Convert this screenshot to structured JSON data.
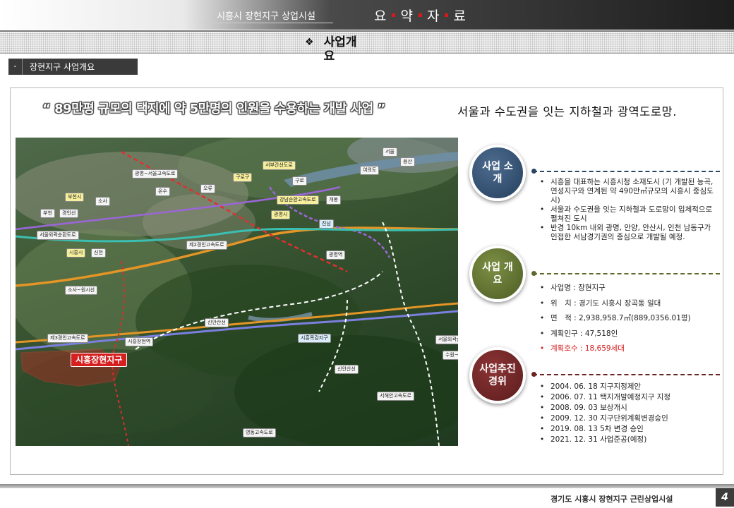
{
  "header": {
    "subtitle": "시흥시 장현지구 상업시설",
    "title_chars": [
      "요",
      "약",
      "자",
      "료"
    ]
  },
  "section": {
    "title": "사업개요",
    "badge_marker": "-",
    "badge_label": "장현지구 사업개요"
  },
  "quote": "“ 89만평 규모의 택지에 약 5만명의 인원을 수용하는 개발 사업 ”",
  "headline": "서울과 수도권을 잇는 지하철과 광역도로망.",
  "map": {
    "labels": {
      "seoul": "서울",
      "yongsan": "용산",
      "yeouido": "여의도",
      "west_arterial": "서부간선도로",
      "gwangmyeong_seoul_exp": "광명~서울고속도로",
      "bucheon": "부천시",
      "bucheon2": "부천",
      "gyeongin": "경인선",
      "sosa": "소사",
      "seoul_outer_ring": "서울외곽순환도로",
      "siheung_city": "시흥시",
      "sincheon": "신천",
      "second_gyeongin": "제2경인고속도로",
      "gangnam_loop": "강남순환고속도로",
      "gwangmyeong_city": "광명시",
      "sosa_wonsi": "소사~원시선",
      "sinan_line": "신안산선",
      "third_gyeongin": "제3경인고속도로",
      "siheung_station": "시흥장현역",
      "siheung_janghyeon": "시흥장현지구",
      "siheung_mokgam": "시흥목감지구",
      "seohaean": "서해안고속도로",
      "yeongdong": "영동고속도로",
      "seoul_outer_ring2": "서울외곽순환",
      "suwon": "수원~광",
      "gwangmyeong_station": "광명역",
      "jinnam": "진남",
      "onsu": "온수",
      "guro": "구로",
      "gaebong": "개봉",
      "oryu": "오류",
      "sinan_line2": "신안산선",
      "guro_yard": "구로구"
    }
  },
  "panels": [
    {
      "circle": "사업 소개",
      "color": "#2a4666",
      "items": [
        "시흥을 대표하는 시흥시청 소재도시 (기 개발된 능곡, 연성지구와 연계된 약 490만㎡규모의 시흥시 중심도시)",
        "서울과 수도권을 잇는 지하철과 도로망이 입체적으로 펼쳐진 도시",
        "반경 10km 내외 광명, 안양, 안산시, 인천 남동구가 인접한 서남경기권의 중심으로 개발될 예정."
      ]
    },
    {
      "circle": "사업 개요",
      "color": "#5b6a2c",
      "items": [
        "사업명 : 장현지구",
        "위　치 : 경기도 시흥시 장곡동 일대",
        "면　적 : 2,938,958.7㎡(889,0356.01평)",
        "계획인구 : 47,518인",
        "계획호수 : 18,659세대"
      ]
    },
    {
      "circle": "사업추진 경위",
      "color": "#6b2222",
      "items": [
        "2004. 06. 18 지구지정제안",
        "2006. 07. 11 택지개발예정지구 지정",
        "2008. 09. 03 보상개시",
        "2009. 12. 30 지구단위계획변경승인",
        "2019. 08. 13 5차 변경 승인",
        "2021. 12. 31 사업준공(예정)"
      ]
    }
  ],
  "footer": {
    "text": "경기도 시흥시 장현지구 근린상업시설",
    "page": "4"
  }
}
